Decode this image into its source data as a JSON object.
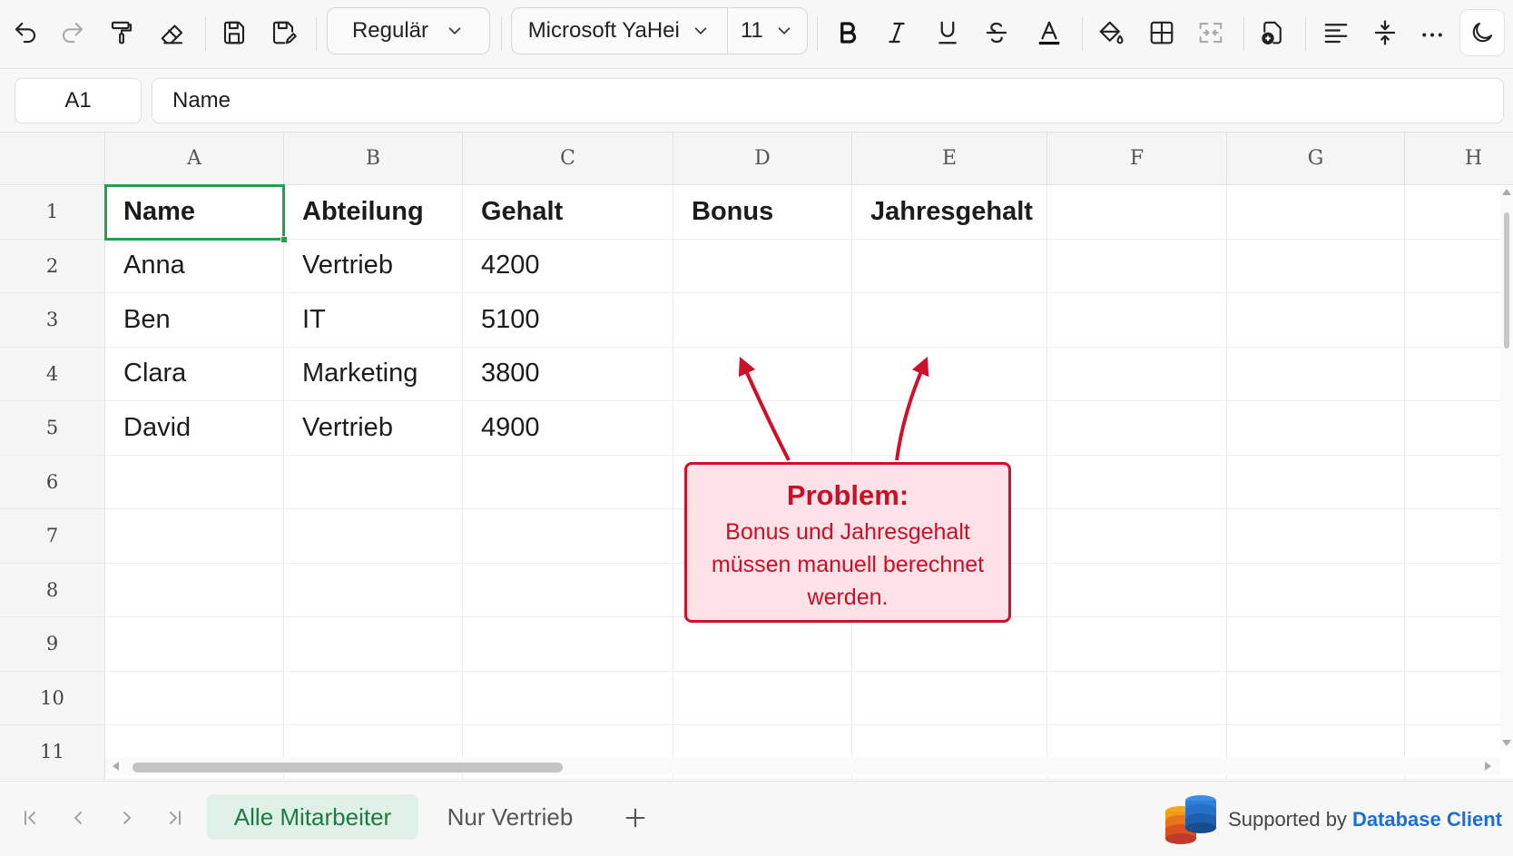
{
  "toolbar": {
    "style_dropdown": "Regulär",
    "font_dropdown": "Microsoft YaHei",
    "size_dropdown": "11"
  },
  "formula_bar": {
    "cell_ref": "A1",
    "content": "Name"
  },
  "grid": {
    "columns": [
      "A",
      "B",
      "C",
      "D",
      "E",
      "F",
      "G",
      "H"
    ],
    "rows": [
      "1",
      "2",
      "3",
      "4",
      "5",
      "6",
      "7",
      "8",
      "9",
      "10",
      "11"
    ],
    "header_row": [
      "Name",
      "Abteilung",
      "Gehalt",
      "Bonus",
      "Jahresgehalt"
    ],
    "data_rows": [
      [
        "Anna",
        "Vertrieb",
        "4200"
      ],
      [
        "Ben",
        "IT",
        "5100"
      ],
      [
        "Clara",
        "Marketing",
        "3800"
      ],
      [
        "David",
        "Vertrieb",
        "4900"
      ]
    ]
  },
  "annotation": {
    "title": "Problem:",
    "line1": "Bonus und Jahresgehalt",
    "line2": "müssen manuell berechnet",
    "line3": "werden.",
    "color": "#d0102a"
  },
  "sheets": {
    "tabs": [
      "Alle Mitarbeiter",
      "Nur Vertrieb"
    ],
    "active_tab": "Alle Mitarbeiter"
  },
  "branding": {
    "prefix": "Supported by",
    "name": "Database Client"
  },
  "colors": {
    "selection": "#21a148",
    "active_tab_bg": "#dff0e6",
    "active_tab_text": "#1e7a43",
    "brand_blue": "#1a6fd6"
  }
}
